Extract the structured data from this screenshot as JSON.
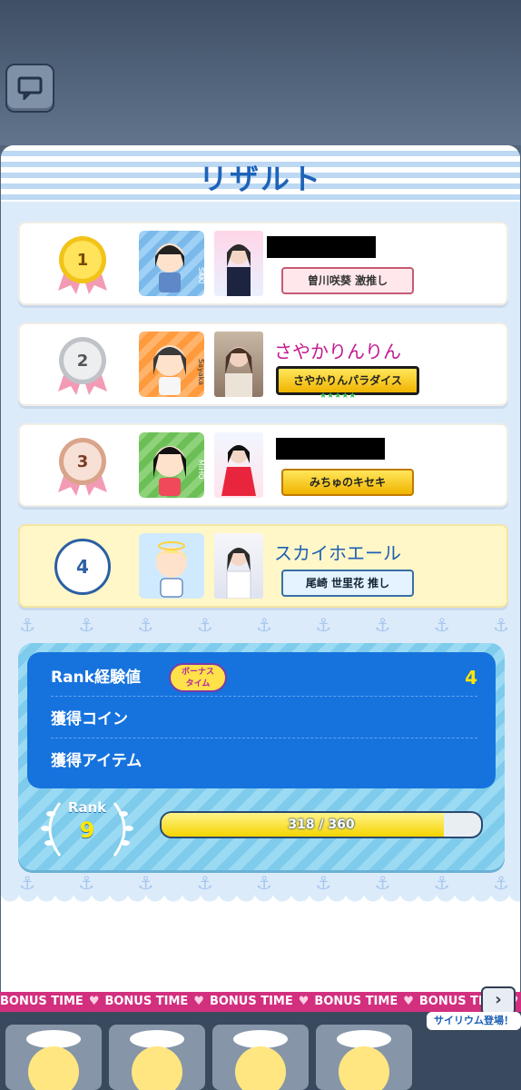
{
  "panel": {
    "title": "リザルト"
  },
  "results": [
    {
      "rank": "1",
      "medal": "gold",
      "avatar_tag": "SAKI",
      "name": "",
      "badge": "曽川咲葵 激推し",
      "badge_style": "pink"
    },
    {
      "rank": "2",
      "medal": "silver",
      "avatar_tag": "Sayaka",
      "name": "さやかりんりん",
      "badge": "さやかりんパラダイス",
      "badge_style": "goldbig"
    },
    {
      "rank": "3",
      "medal": "bronze",
      "avatar_tag": "MIHO",
      "name": "",
      "badge": "みちゅのキセキ",
      "badge_style": "gold"
    },
    {
      "rank": "4",
      "medal": "none",
      "avatar_tag": "",
      "name": "スカイホエール",
      "badge": "尾崎 世里花 推し",
      "badge_style": "blue"
    }
  ],
  "summary": {
    "rank_exp_label": "Rank経験値",
    "bonus_label_line1": "ボーナス",
    "bonus_label_line2": "タイム",
    "rank_exp_value": "4",
    "coin_label": "獲得コイン",
    "item_label": "獲得アイテム",
    "rank_title": "Rank",
    "rank_value": "9",
    "exp_text": "318 / 360",
    "exp_fraction": 0.883
  },
  "footer": {
    "marquee_text": "BONUS TIME",
    "next_icon": "chevron-right-icon",
    "psyllium_label": "サイリウム登場！"
  },
  "colors": {
    "title": "#1d63b8",
    "name_pink": "#c2188f",
    "name_blue": "#1d5fb4",
    "marquee": "#d32f7f"
  }
}
